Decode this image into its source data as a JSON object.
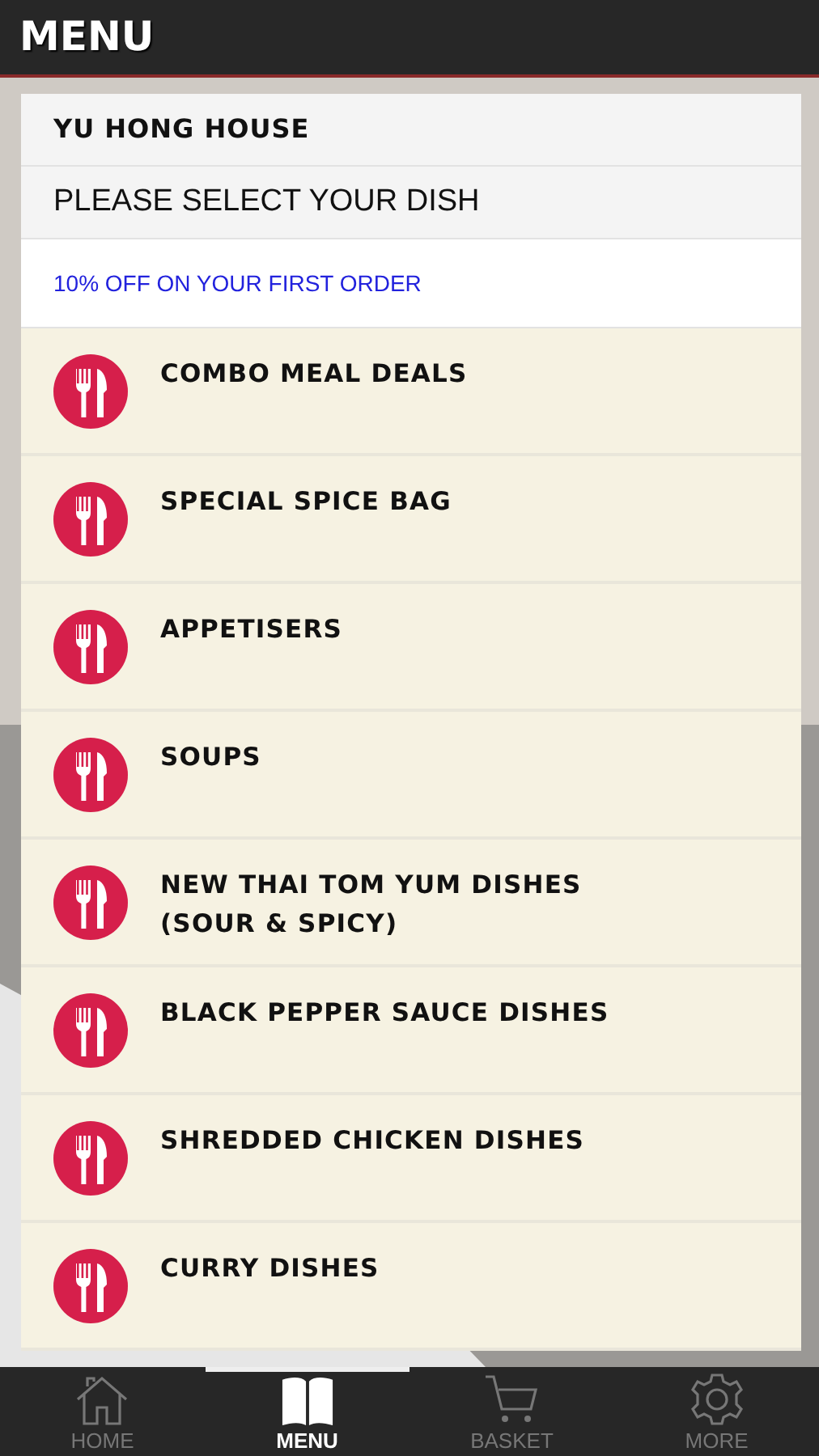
{
  "header": {
    "title": "MENU"
  },
  "restaurant": {
    "name": "YU HONG HOUSE",
    "prompt": "PLEASE SELECT YOUR DISH",
    "promo": "10% OFF ON YOUR FIRST ORDER"
  },
  "categories": [
    {
      "label": "COMBO MEAL DEALS"
    },
    {
      "label": "SPECIAL SPICE BAG"
    },
    {
      "label": "APPETISERS"
    },
    {
      "label": "SOUPS"
    },
    {
      "label": "NEW THAI TOM YUM DISHES (SOUR & SPICY)"
    },
    {
      "label": "BLACK PEPPER SAUCE DISHES"
    },
    {
      "label": "SHREDDED CHICKEN DISHES"
    },
    {
      "label": "CURRY DISHES"
    }
  ],
  "bottom_nav": [
    {
      "label": "HOME",
      "selected": false
    },
    {
      "label": "MENU",
      "selected": true
    },
    {
      "label": "BASKET",
      "selected": false
    },
    {
      "label": "MORE",
      "selected": false
    }
  ]
}
